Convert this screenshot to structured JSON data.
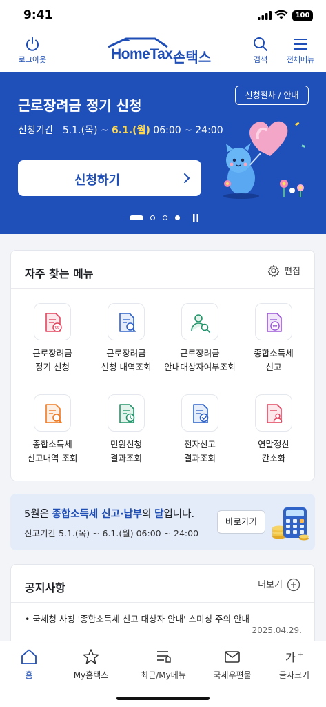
{
  "status_bar": {
    "time": "9:41",
    "battery": "100"
  },
  "header": {
    "logout_label": "로그아웃",
    "logo_text": "HomeTax.",
    "logo_sub": "손택스",
    "search_label": "검색",
    "menu_label": "전체메뉴"
  },
  "banner": {
    "title": "근로장려금 정기 신청",
    "period_label": "신청기간",
    "period_start": "5.1.(목) ~ ",
    "period_end": "6.1.(월)",
    "period_time": " 06:00 ~ 24:00",
    "procedure_button": "신청절차 / 안내",
    "apply_button": "신청하기",
    "slide_count": 4,
    "slide_active": 1
  },
  "quick_menu": {
    "title": "자주 찾는 메뉴",
    "edit_label": "편집",
    "items": [
      {
        "line1": "근로장려금",
        "line2": "정기 신청",
        "icon": "won-document-icon",
        "color": "#e2465f"
      },
      {
        "line1": "근로장려금",
        "line2": "신청 내역조회",
        "icon": "document-search-icon",
        "color": "#2f63c8"
      },
      {
        "line1": "근로장려금",
        "line2": "안내대상자여부조회",
        "icon": "person-search-icon",
        "color": "#22956a"
      },
      {
        "line1": "종합소득세",
        "line2": "신고",
        "icon": "won-document-icon",
        "color": "#9a56d6"
      },
      {
        "line1": "종합소득세",
        "line2": "신고내역 조회",
        "icon": "document-search-icon",
        "color": "#ef7a22"
      },
      {
        "line1": "민원신청",
        "line2": "결과조회",
        "icon": "document-clock-icon",
        "color": "#22956a"
      },
      {
        "line1": "전자신고",
        "line2": "결과조회",
        "icon": "document-check-icon",
        "color": "#2f63c8"
      },
      {
        "line1": "연말정산",
        "line2": "간소화",
        "icon": "document-person-icon",
        "color": "#e2465f"
      }
    ]
  },
  "info_banner": {
    "prefix": "5월은 ",
    "highlight": "종합소득세 신고·납부",
    "mid": "의 ",
    "highlight2": "달",
    "suffix": "입니다.",
    "period": "신고기간   5.1.(목) ~ 6.1.(월) 06:00 ~ 24:00",
    "button": "바로가기"
  },
  "notice": {
    "title": "공지사항",
    "more_label": "더보기",
    "items": [
      {
        "text": "• 국세청 사칭 '종합소득세 신고 대상자 안내' 스미싱 주의 안내",
        "date": "2025.04.29."
      }
    ]
  },
  "bottom_nav": {
    "items": [
      {
        "label": "홈",
        "icon": "home-icon",
        "active": true
      },
      {
        "label": "My홈택스",
        "icon": "star-icon",
        "active": false
      },
      {
        "label": "최근/My메뉴",
        "icon": "list-icon",
        "active": false
      },
      {
        "label": "국세우편물",
        "icon": "mail-icon",
        "active": false
      },
      {
        "label": "글자크기",
        "icon": "font-size-icon",
        "active": false
      }
    ]
  },
  "colors": {
    "brand": "#1f4fb6",
    "banner_bg": "#1f4fb9",
    "highlight": "#ffd84d"
  }
}
